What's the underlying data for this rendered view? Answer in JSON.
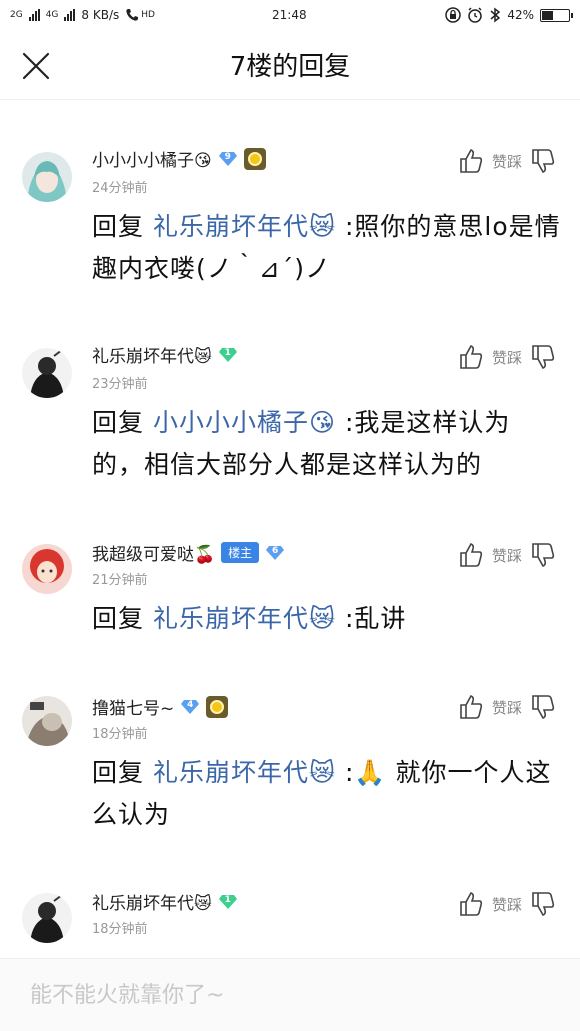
{
  "status_bar": {
    "network": "2G",
    "network2": "4G",
    "speed": "8 KB/s",
    "hd": "HD",
    "time": "21:48",
    "battery": "42%",
    "battery_level": 0.42
  },
  "header": {
    "title": "7楼的回复"
  },
  "vote_label": "赞踩",
  "reply_prefix": "回复",
  "replies": [
    {
      "username": "小小小小橘子😘",
      "level": "9",
      "time": "24分钟前",
      "mention": "礼乐崩坏年代😿",
      "text": ":照你的意思lo是情趣内衣喽(ノ｀⊿´)ノ"
    },
    {
      "username": "礼乐崩坏年代😿",
      "level": "1",
      "time": "23分钟前",
      "mention": "小小小小橘子😘",
      "text": ":我是这样认为的，相信大部分人都是这样认为的"
    },
    {
      "username": "我超级可爱哒🍒",
      "owner_tag": "楼主",
      "level": "6",
      "time": "21分钟前",
      "mention": "礼乐崩坏年代😿",
      "text": ":乱讲"
    },
    {
      "username": "撸猫七号~",
      "level": "4",
      "time": "18分钟前",
      "mention": "礼乐崩坏年代😿",
      "text": ":🙏 就你一个人这么认为"
    },
    {
      "username": "礼乐崩坏年代😿",
      "level": "1",
      "time": "18分钟前"
    }
  ],
  "input": {
    "placeholder": "能不能火就靠你了~"
  },
  "colors": {
    "mention": "#3b67a8",
    "owner_tag": "#3a84e6",
    "gem_blue": "#5b9ff0",
    "gem_green": "#3ccf8e"
  }
}
